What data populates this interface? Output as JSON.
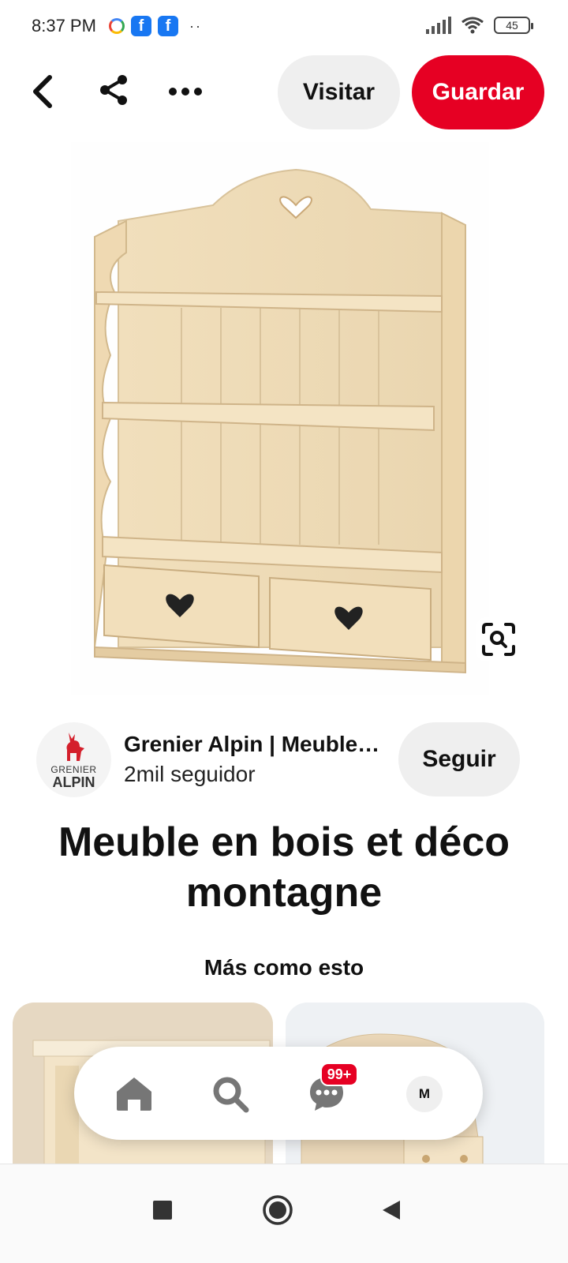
{
  "status_bar": {
    "time": "8:37 PM",
    "left_icons": [
      "google-icon",
      "facebook-icon",
      "facebook-icon",
      "more-notifications-icon"
    ],
    "battery": "45"
  },
  "top_bar": {
    "visit_label": "Visitar",
    "save_label": "Guardar",
    "accent_color": "#e60023"
  },
  "creator": {
    "avatar_top": "GRENIER",
    "avatar_bottom": "ALPIN",
    "name": "Grenier Alpin | Meuble…",
    "followers": "2mil seguidor",
    "follow_label": "Seguir"
  },
  "pin": {
    "title": "Meuble en bois et déco montagne"
  },
  "related": {
    "heading": "Más como esto"
  },
  "bottom_nav": {
    "items": [
      "home-icon",
      "search-icon",
      "messages-icon",
      "profile"
    ],
    "badge": "99+",
    "profile_initial": "M"
  }
}
